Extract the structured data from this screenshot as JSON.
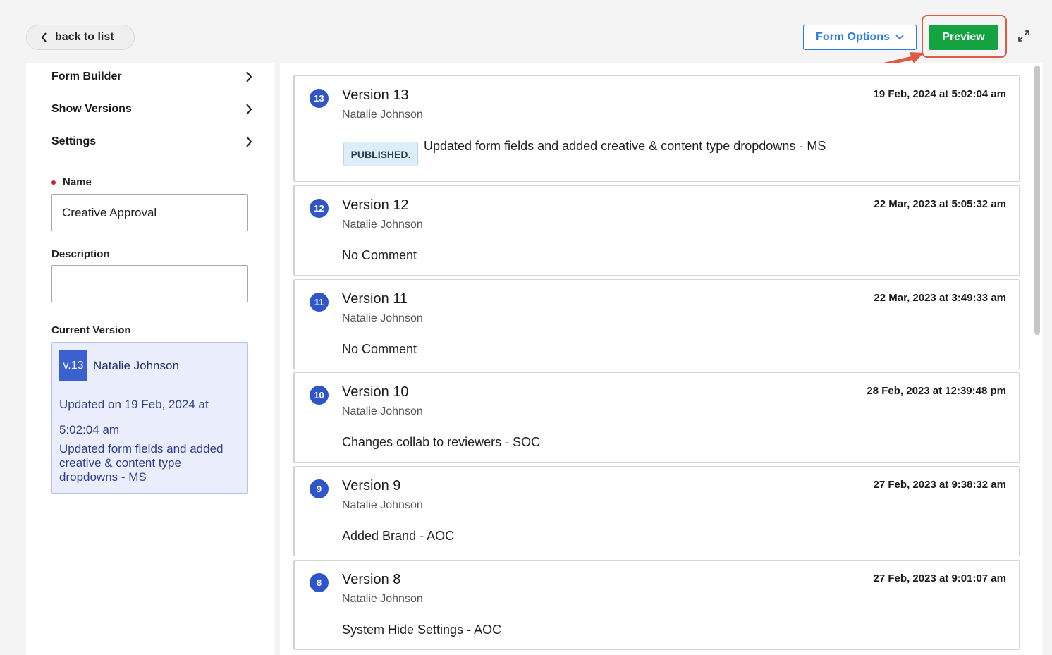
{
  "header": {
    "back_label": "back to list",
    "form_options_label": "Form Options",
    "preview_label": "Preview"
  },
  "sidebar": {
    "nav": [
      {
        "label": "Form Builder"
      },
      {
        "label": "Show Versions"
      },
      {
        "label": "Settings"
      }
    ],
    "name_label": "Name",
    "name_value": "Creative Approval",
    "description_label": "Description",
    "description_value": "",
    "current_version_label": "Current Version",
    "current_version": {
      "badge": "v.13",
      "author": "Natalie Johnson",
      "updated": "Updated on 19 Feb, 2024 at 5:02:04 am",
      "comment": "Updated form fields and added creative & content type dropdowns - MS"
    }
  },
  "versions": [
    {
      "num": "13",
      "title": "Version 13",
      "author": "Natalie Johnson",
      "date": "19 Feb, 2024 at 5:02:04 am",
      "status": "PUBLISHED.",
      "comment": "Updated form fields and added creative & content type dropdowns - MS"
    },
    {
      "num": "12",
      "title": "Version 12",
      "author": "Natalie Johnson",
      "date": "22 Mar, 2023 at 5:05:32 am",
      "comment": "No Comment"
    },
    {
      "num": "11",
      "title": "Version 11",
      "author": "Natalie Johnson",
      "date": "22 Mar, 2023 at 3:49:33 am",
      "comment": "No Comment"
    },
    {
      "num": "10",
      "title": "Version 10",
      "author": "Natalie Johnson",
      "date": "28 Feb, 2023 at 12:39:48 pm",
      "comment": "Changes collab to reviewers - SOC"
    },
    {
      "num": "9",
      "title": "Version 9",
      "author": "Natalie Johnson",
      "date": "27 Feb, 2023 at 9:38:32 am",
      "comment": "Added Brand - AOC"
    },
    {
      "num": "8",
      "title": "Version 8",
      "author": "Natalie Johnson",
      "date": "27 Feb, 2023 at 9:01:07 am",
      "comment": "System Hide Settings - AOC"
    }
  ],
  "colors": {
    "accent_blue": "#2b7de1",
    "preview_green": "#15a341",
    "highlight_red": "#e05a44",
    "version_badge": "#2f55c8"
  },
  "icons": {
    "back": "chevron-left-icon",
    "dropdown": "chevron-down-icon",
    "nav": "chevron-right-icon",
    "expand": "expand-icon"
  }
}
